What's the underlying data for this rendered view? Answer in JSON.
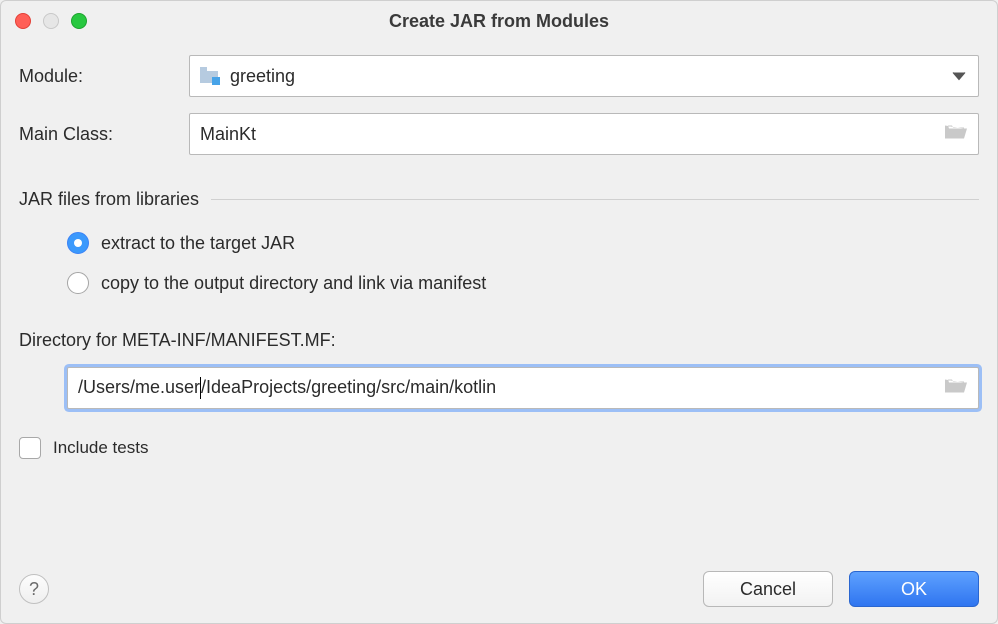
{
  "window": {
    "title": "Create JAR from Modules"
  },
  "fields": {
    "module": {
      "label": "Module:",
      "value": "greeting"
    },
    "mainClass": {
      "label": "Main Class:",
      "value": "MainKt"
    }
  },
  "libSection": {
    "title": "JAR files from libraries",
    "options": {
      "extract": "extract to the target JAR",
      "copy": "copy to the output directory and link via manifest",
      "selected": "extract"
    }
  },
  "manifest": {
    "label": "Directory for META-INF/MANIFEST.MF:",
    "value": "/Users/me.user/IdeaProjects/greeting/src/main/kotlin"
  },
  "includeTests": {
    "label": "Include tests",
    "checked": false
  },
  "buttons": {
    "cancel": "Cancel",
    "ok": "OK"
  },
  "icons": {
    "module": "module-icon",
    "chevron": "chevron-down-icon",
    "folder": "folder-open-icon",
    "help": "help-icon"
  },
  "colors": {
    "accent": "#3b99fc",
    "primaryBtn": "#3d7ff3",
    "focusRing": "#83b5fb"
  }
}
